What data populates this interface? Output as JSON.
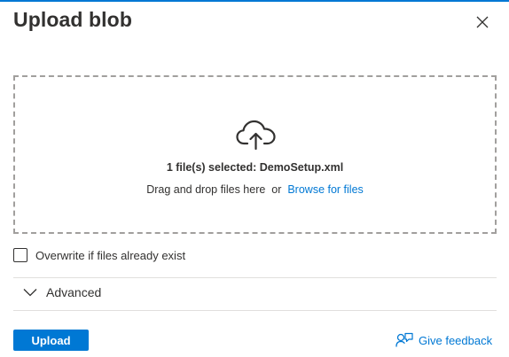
{
  "dialog": {
    "title": "Upload blob",
    "close_icon": "close-icon"
  },
  "dropzone": {
    "icon": "cloud-upload-icon",
    "selected_text": "1 file(s) selected: DemoSetup.xml",
    "drag_text": "Drag and drop files here",
    "or_text": "or",
    "browse_link": "Browse for files"
  },
  "overwrite": {
    "label": "Overwrite if files already exist",
    "checked": false
  },
  "advanced": {
    "label": "Advanced",
    "icon": "chevron-down-icon",
    "expanded": false
  },
  "footer": {
    "upload_label": "Upload",
    "feedback_label": "Give feedback",
    "feedback_icon": "feedback-icon"
  },
  "colors": {
    "accent": "#0078d4",
    "text": "#323130",
    "dashed_border": "#a19f9d",
    "divider": "#e1dfdd"
  }
}
